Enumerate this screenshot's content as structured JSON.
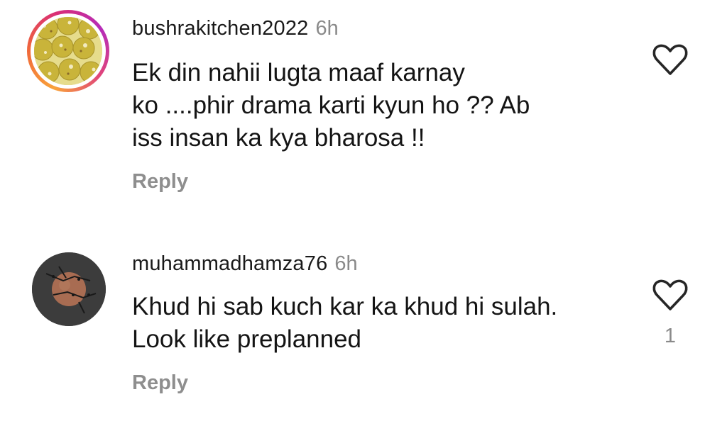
{
  "comments": [
    {
      "username": "bushrakitchen2022",
      "time": "6h",
      "text": "Ek din nahii lugta maaf karnay\nko ....phir drama karti kyun ho ?? Ab\niss insan ka kya bharosa !!",
      "reply_label": "Reply",
      "like_icon": "heart-outline-icon",
      "has_story_ring": true
    },
    {
      "username": "muhammadhamza76",
      "time": "6h",
      "text": "Khud hi sab kuch kar ka khud hi sulah.\nLook like preplanned",
      "reply_label": "Reply",
      "like_icon": "heart-outline-icon",
      "like_count": "1",
      "has_story_ring": false
    }
  ],
  "colors": {
    "username": "#1a1a1a",
    "secondary_text": "#8e8e8e",
    "story_ring_start": "#f9a33a",
    "story_ring_end": "#b62cb9"
  }
}
